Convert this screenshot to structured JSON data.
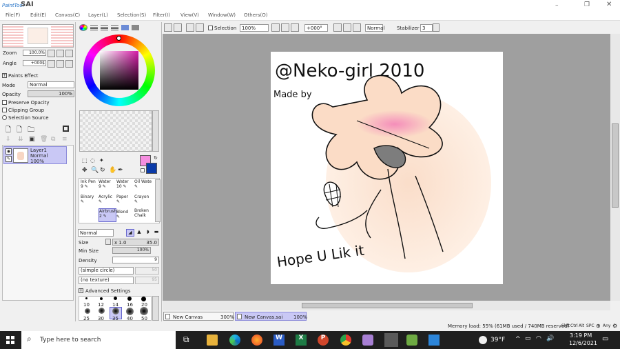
{
  "app": {
    "title": "Paint Tool SAI",
    "logo_small": "PaintTool",
    "logo_big": "SAI"
  },
  "menu": [
    {
      "label": "File",
      "key": "F"
    },
    {
      "label": "Edit",
      "key": "E"
    },
    {
      "label": "Canvas",
      "key": "C"
    },
    {
      "label": "Layer",
      "key": "L"
    },
    {
      "label": "Selection",
      "key": "S"
    },
    {
      "label": "Filter",
      "key": "I"
    },
    {
      "label": "View",
      "key": "V"
    },
    {
      "label": "Window",
      "key": "W"
    },
    {
      "label": "Others",
      "key": "O"
    }
  ],
  "toolbar": {
    "selection_label": "Selection",
    "zoom": "100%",
    "angle": "+000°",
    "blend": "Normal",
    "stabilizer_label": "Stabilizer",
    "stabilizer_value": "3"
  },
  "navigator": {
    "zoom_label": "Zoom",
    "zoom_value": "100.0%",
    "angle_label": "Angle",
    "angle_value": "+000$"
  },
  "layer_panel": {
    "paints_effect": "Paints Effect",
    "mode_label": "Mode",
    "mode_value": "Normal",
    "opacity_label": "Opacity",
    "opacity_value": "100%",
    "preserve_opacity": "Preserve Opacity",
    "clipping_group": "Clipping Group",
    "selection_source": "Selection Source",
    "layer": {
      "name": "Layer1",
      "mode": "Normal",
      "opacity": "100%"
    }
  },
  "colors": {
    "primary": "#f58ee0",
    "secondary": "#0a3aa8",
    "layer_highlight": "#c9c8f5"
  },
  "brushes": [
    {
      "label": "Ink Pen",
      "num": "9"
    },
    {
      "label": "Water",
      "num": "9"
    },
    {
      "label": "Water",
      "num": "10"
    },
    {
      "label": "Oil Wate",
      "num": ""
    },
    {
      "label": "Binary",
      "num": ""
    },
    {
      "label": "Acrylic",
      "num": ""
    },
    {
      "label": "Paper",
      "num": ""
    },
    {
      "label": "Crayon",
      "num": ""
    },
    {
      "label": "",
      "num": ""
    },
    {
      "label": "Airbrush",
      "num": "2"
    },
    {
      "label": "Blend",
      "num": ""
    },
    {
      "label": "Broken Chalk",
      "num": ""
    }
  ],
  "brush_settings": {
    "blend_mode": "Normal",
    "size_label": "Size",
    "size_mult": "x 1.0",
    "size_value": "35.0",
    "min_size_label": "Min Size",
    "min_size_value": "100%",
    "density_label": "Density",
    "density_value": "9",
    "shape": "(simple circle)",
    "shape_value": "50",
    "texture": "(no texture)",
    "texture_value": "95",
    "advanced": "Advanced Settings",
    "dot_sizes_row1": [
      "10",
      "12",
      "14",
      "16",
      "20"
    ],
    "dot_sizes_row2": [
      "25",
      "30",
      "35",
      "40",
      "50"
    ]
  },
  "tabs": [
    {
      "name": "New Canvas",
      "zoom": "300%"
    },
    {
      "name": "New Canvas.sai",
      "zoom": "100%"
    }
  ],
  "status": {
    "memory": "Memory load: 55% (61MB used / 740MB reserved)",
    "keys": [
      "Shft",
      "Ctrl",
      "Alt",
      "SPC"
    ],
    "any": "Any"
  },
  "taskbar": {
    "search_placeholder": "Type here to search",
    "weather": "39°F",
    "time": "3:19 PM",
    "date": "12/6/2021"
  },
  "artwork": {
    "handle": "@Neko-girl 2010",
    "made_by": "Made by",
    "footer": "Hope U Lik it"
  }
}
